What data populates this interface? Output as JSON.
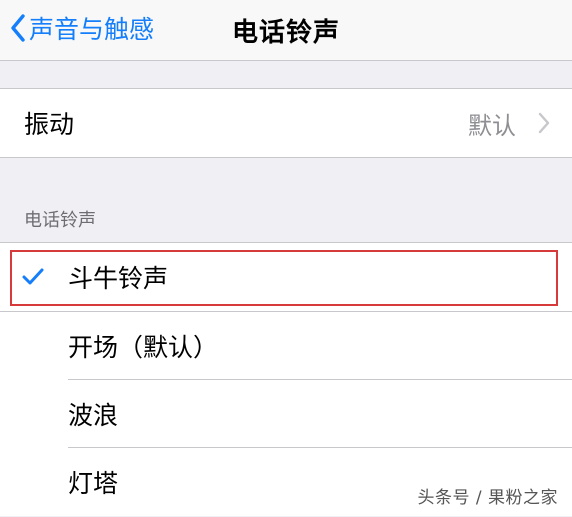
{
  "nav": {
    "back_label": "声音与触感",
    "title": "电话铃声"
  },
  "vibration": {
    "label": "振动",
    "value": "默认"
  },
  "section_header": "电话铃声",
  "ringtones": [
    {
      "name": "斗牛铃声",
      "selected": true
    },
    {
      "name": "开场（默认）",
      "selected": false
    },
    {
      "name": "波浪",
      "selected": false
    },
    {
      "name": "灯塔",
      "selected": false
    }
  ],
  "watermark": "头条号 / 果粉之家",
  "colors": {
    "accent": "#147efb",
    "highlight_box": "#d63a3a",
    "background": "#efeff4"
  },
  "icons": [
    "chevron-left-icon",
    "chevron-right-icon",
    "checkmark-icon"
  ]
}
